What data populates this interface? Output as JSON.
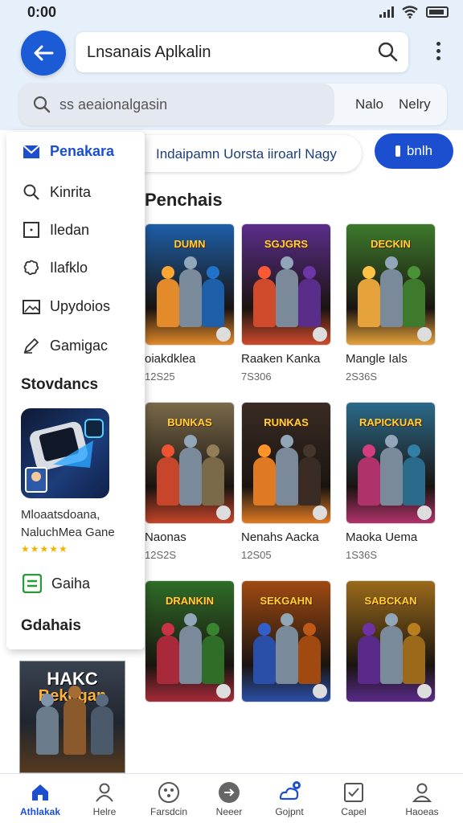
{
  "status_bar": {
    "time": "0:00"
  },
  "header": {
    "title": "Lnsanais Aplkalin",
    "search_placeholder": "ss aeaionalgasin",
    "sort_label": "Nalo",
    "menu_label": "Nelry"
  },
  "filter": {
    "text": "Indaipamn Uorsta iiroarl  Nagy",
    "button_label": "bnlh"
  },
  "section_title": "Penchais",
  "drawer": {
    "items": [
      {
        "label": "Penakara",
        "icon": "mail-icon"
      },
      {
        "label": "Kinrita",
        "icon": "search-icon"
      },
      {
        "label": "Iledan",
        "icon": "square-icon"
      },
      {
        "label": "Ilafklo",
        "icon": "puzzle-icon"
      },
      {
        "label": "Upydoios",
        "icon": "image-icon"
      },
      {
        "label": "Gamigac",
        "icon": "pen-icon"
      }
    ],
    "heading_1": "Stovdancs",
    "promo_line_1": "Mloaatsdoana,",
    "promo_line_2": "NaluchMea Gane",
    "stars": "★★★★★",
    "bottom_item": "Gaiha",
    "heading_2": "Gdahais"
  },
  "games": [
    {
      "cover_title": "DUMN",
      "name": "oiakdklea",
      "count": "12S25",
      "palette": [
        "#1d5fa8",
        "#e38a2a"
      ]
    },
    {
      "cover_title": "SGJGRS",
      "name": "Raaken Kanka",
      "count": "7S306",
      "palette": [
        "#5b2d8a",
        "#d04a2c"
      ]
    },
    {
      "cover_title": "DECKIN",
      "name": "Mangle Ials",
      "count": "2S36S",
      "palette": [
        "#3d7a2c",
        "#e6a23a"
      ]
    },
    {
      "cover_title": "BUNKAS",
      "name": "Naonas",
      "count": "12S2S",
      "palette": [
        "#7a6a4a",
        "#c7452a"
      ]
    },
    {
      "cover_title": "RUNKAS",
      "name": "Nenahs Aacka",
      "count": "12S05",
      "palette": [
        "#3a2c24",
        "#e07a22"
      ]
    },
    {
      "cover_title": "RAPICKUAR",
      "name": "Maoka Uema",
      "count": "1S36S",
      "palette": [
        "#2a6a8a",
        "#b0326a"
      ]
    },
    {
      "cover_title": "DRANKIN",
      "name": "",
      "count": "",
      "palette": [
        "#2f6d28",
        "#a82a3a"
      ]
    },
    {
      "cover_title": "SEKGAHN",
      "name": "",
      "count": "",
      "palette": [
        "#a04a12",
        "#2a4fa8"
      ]
    },
    {
      "cover_title": "SABCKAN",
      "name": "",
      "count": "",
      "palette": [
        "#9a6a1a",
        "#5a2a8a"
      ]
    }
  ],
  "poster": {
    "line_1": "HAKC",
    "line_2": "Bekogan"
  },
  "bottom_nav": [
    {
      "label": "Athlakak",
      "icon": "home-icon",
      "active": true
    },
    {
      "label": "Helre",
      "icon": "person-icon",
      "active": false
    },
    {
      "label": "Farsdcin",
      "icon": "gamepad-icon",
      "active": false
    },
    {
      "label": "Neeer",
      "icon": "arrow-circle-icon",
      "active": false
    },
    {
      "label": "Gojpnt",
      "icon": "cloud-badge-icon",
      "active": false
    },
    {
      "label": "Capel",
      "icon": "checkbox-icon",
      "active": false
    },
    {
      "label": "Haoeas",
      "icon": "profile-icon",
      "active": false
    }
  ]
}
